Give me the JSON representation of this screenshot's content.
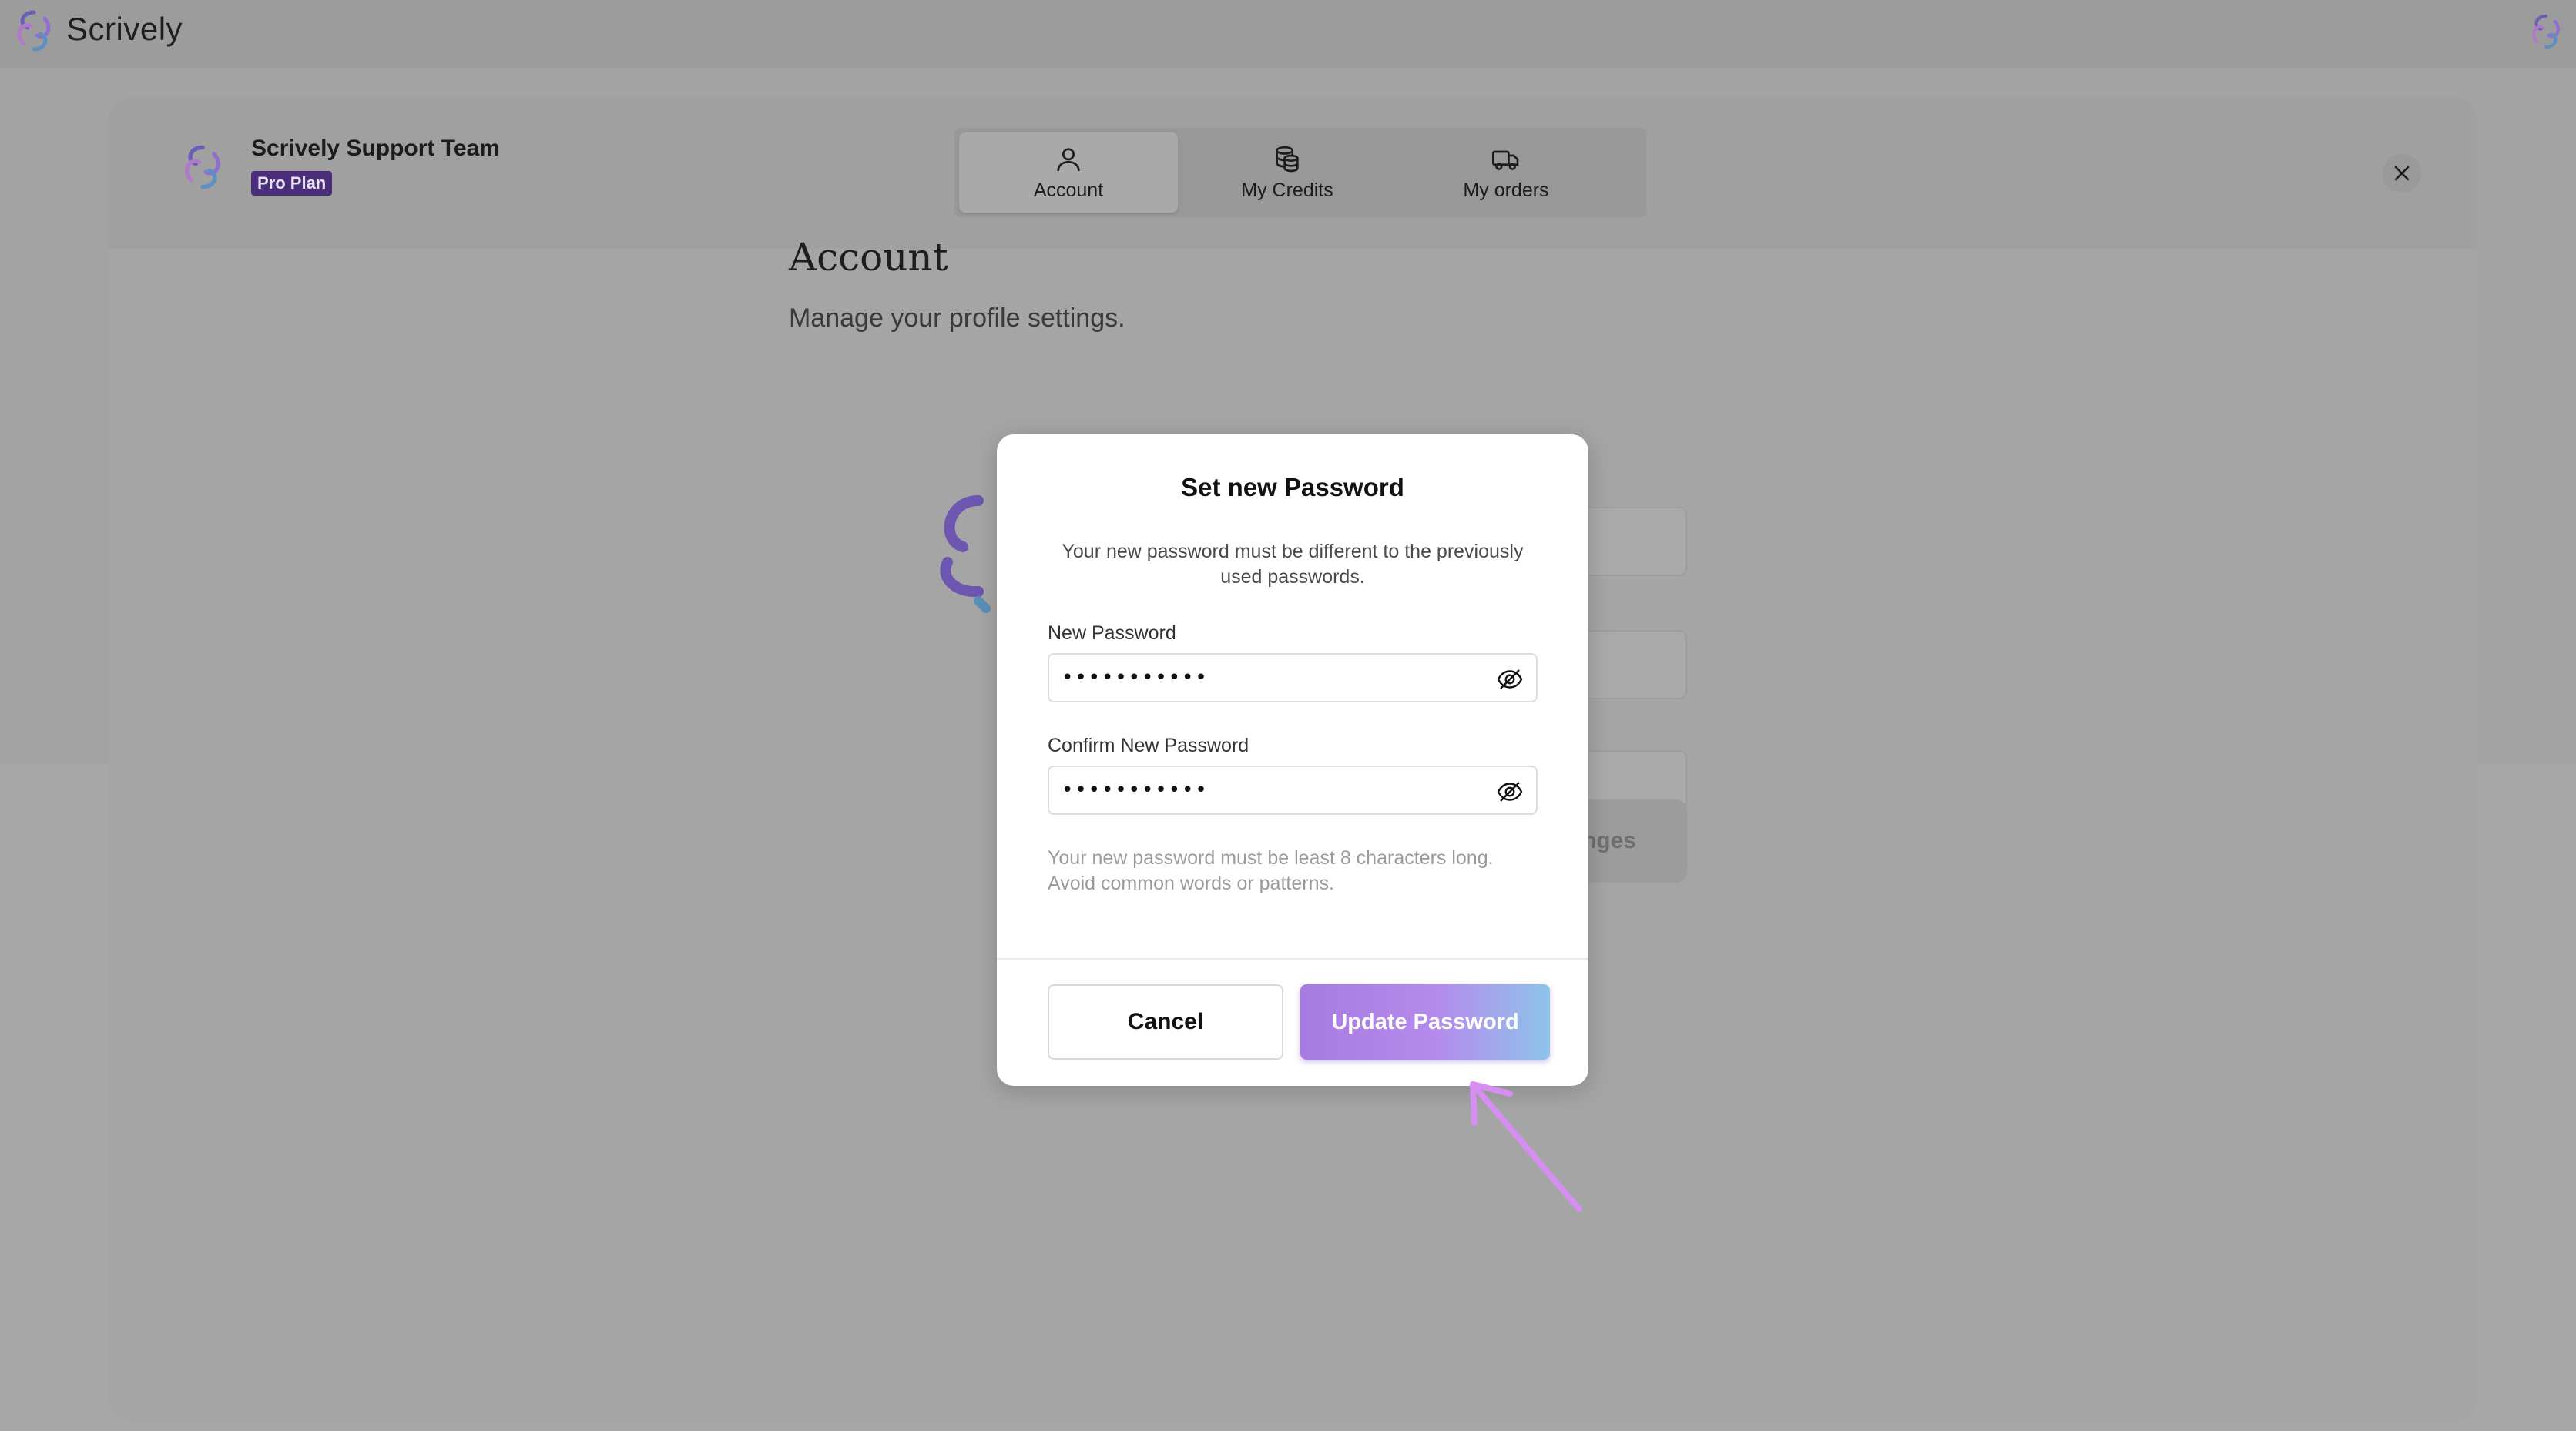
{
  "topbar": {
    "brand": "Scrively"
  },
  "panel": {
    "user_name": "Scrively Support Team",
    "plan": "Pro Plan",
    "tabs": [
      {
        "label": "Account",
        "icon": "user-icon",
        "active": true
      },
      {
        "label": "My Credits",
        "icon": "coins-icon",
        "active": false
      },
      {
        "label": "My orders",
        "icon": "truck-icon",
        "active": false
      }
    ],
    "close_icon": "close-icon"
  },
  "account": {
    "title": "Account",
    "subtitle": "Manage your profile settings.",
    "save_partial": "nges"
  },
  "modal": {
    "title": "Set new Password",
    "description": "Your new password must be different to the previously used passwords.",
    "new_password_label": "New Password",
    "new_password_value": "•••••••••••",
    "confirm_label": "Confirm New Password",
    "confirm_value": "•••••••••••",
    "hint": "Your new password must be least 8 characters long. Avoid common words or patterns.",
    "cancel_label": "Cancel",
    "update_label": "Update Password"
  },
  "colors": {
    "accent_purple": "#a77ae2",
    "accent_blue": "#8ec4ea",
    "badge": "#4b2e7a",
    "arrow": "#d58ff0"
  }
}
